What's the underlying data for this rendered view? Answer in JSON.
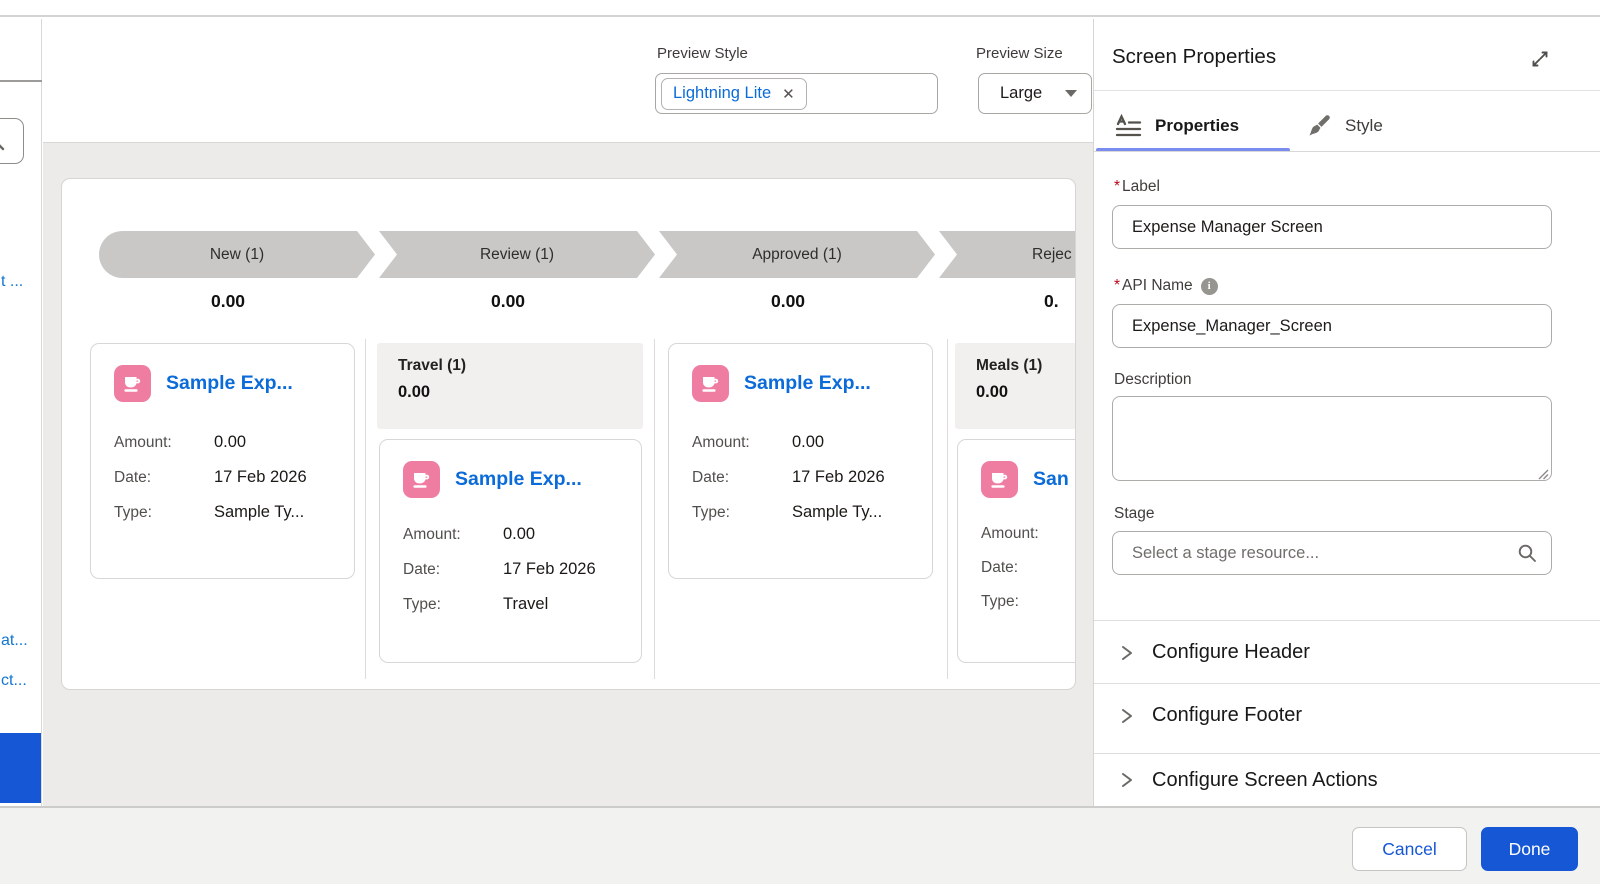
{
  "toolbar": {
    "preview_style": {
      "label": "Preview Style",
      "selected": "Lightning Lite"
    },
    "preview_size": {
      "label": "Preview Size",
      "selected": "Large"
    }
  },
  "left_rail": {
    "link_top": "t ...",
    "link_mid": "at...",
    "link_bottom": "ct..."
  },
  "preview": {
    "stages": [
      {
        "label": "New (1)",
        "amount": "0.00"
      },
      {
        "label": "Review (1)",
        "amount": "0.00"
      },
      {
        "label": "Approved (1)",
        "amount": "0.00"
      },
      {
        "label": "Rejec",
        "amount": "0."
      }
    ],
    "columns": [
      {
        "cards": [
          {
            "title": "Sample Exp...",
            "rows": [
              {
                "label": "Amount:",
                "value": "0.00"
              },
              {
                "label": "Date:",
                "value": "17 Feb 2026"
              },
              {
                "label": "Type:",
                "value": "Sample Ty..."
              }
            ]
          }
        ]
      },
      {
        "group": {
          "label": "Travel (1)",
          "amount": "0.00"
        },
        "cards": [
          {
            "title": "Sample Exp...",
            "rows": [
              {
                "label": "Amount:",
                "value": "0.00"
              },
              {
                "label": "Date:",
                "value": "17 Feb 2026"
              },
              {
                "label": "Type:",
                "value": "Travel"
              }
            ]
          }
        ]
      },
      {
        "cards": [
          {
            "title": "Sample Exp...",
            "rows": [
              {
                "label": "Amount:",
                "value": "0.00"
              },
              {
                "label": "Date:",
                "value": "17 Feb 2026"
              },
              {
                "label": "Type:",
                "value": "Sample Ty..."
              }
            ]
          }
        ]
      },
      {
        "group": {
          "label": "Meals (1)",
          "amount": "0.00"
        },
        "cards": [
          {
            "title": "San",
            "rows": [
              {
                "label": "Amount:",
                "value": ""
              },
              {
                "label": "Date:",
                "value": ""
              },
              {
                "label": "Type:",
                "value": ""
              }
            ]
          }
        ]
      }
    ]
  },
  "panel": {
    "title": "Screen Properties",
    "tabs": [
      {
        "label": "Properties"
      },
      {
        "label": "Style"
      }
    ],
    "required_marker": "*",
    "fields": {
      "label": {
        "label": "Label",
        "value": "Expense Manager Screen"
      },
      "api_name": {
        "label": "API Name",
        "value": "Expense_Manager_Screen"
      },
      "description": {
        "label": "Description",
        "value": ""
      },
      "stage": {
        "label": "Stage",
        "placeholder": "Select a stage resource..."
      }
    },
    "accordions": [
      {
        "label": "Configure Header"
      },
      {
        "label": "Configure Footer"
      },
      {
        "label": "Configure Screen Actions"
      }
    ]
  },
  "footer": {
    "cancel": "Cancel",
    "done": "Done"
  },
  "icons": {
    "close": "✕",
    "info": "i"
  },
  "colors": {
    "accent_blue": "#0b6bd8",
    "done_blue": "#1657d6",
    "brand_pink": "#ef7da2",
    "tab_underline": "#7b8cf0",
    "stage_gray": "#c9c8c6"
  }
}
